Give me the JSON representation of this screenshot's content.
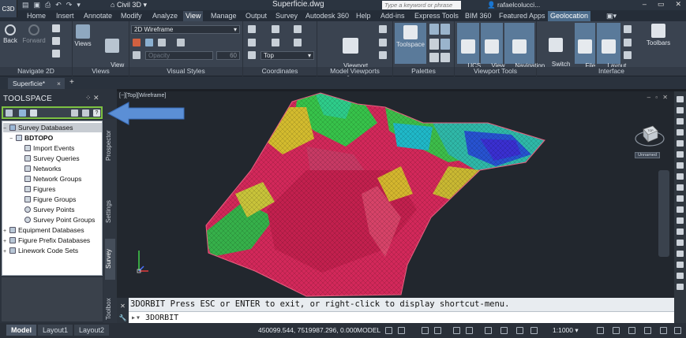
{
  "app_button": "C3D",
  "titlebar": {
    "app_name": "Civil 3D",
    "file_name": "Superficie.dwg",
    "search_placeholder": "Type a keyword or phrase",
    "user": "rafaelcolucci...",
    "window_controls": [
      "–",
      "▭",
      "✕"
    ]
  },
  "ribbon_tabs": [
    "Home",
    "Insert",
    "Annotate",
    "Modify",
    "Analyze",
    "View",
    "Manage",
    "Output",
    "Survey",
    "Autodesk 360",
    "Help",
    "Add-ins",
    "Express Tools",
    "BIM 360",
    "Featured Apps",
    "Geolocation"
  ],
  "active_tab": "View",
  "ribbon": {
    "navigate": {
      "title": "Navigate 2D",
      "back": "Back",
      "forward": "Forward"
    },
    "views": {
      "title": "Views",
      "views": "Views",
      "view_manager": "View\nManager"
    },
    "visual_styles": {
      "title": "Visual Styles",
      "style": "2D Wireframe",
      "opacity": "Opacity",
      "opacity_value": "60"
    },
    "coordinates": {
      "title": "Coordinates",
      "view": "Top"
    },
    "model_viewports": {
      "title": "Model Viewports",
      "viewport_config": "Viewport\nConfiguration"
    },
    "palettes": {
      "title": "Palettes",
      "toolspace": "Toolspace"
    },
    "viewport_tools": {
      "title": "Viewport Tools",
      "ucs_icon": "UCS\nIcon",
      "view_cube": "View\nCube",
      "navigation_bar": "Navigation\nBar"
    },
    "interface": {
      "title": "Interface",
      "switch_windows": "Switch\nWindows",
      "file_tabs": "File\nTabs",
      "layout_tabs": "Layout\nTabs",
      "toolbars": "Toolbars"
    }
  },
  "doc_tab": {
    "label": "Superficie*",
    "close": "×",
    "plus": "+"
  },
  "toolspace": {
    "title": "TOOLSPACE",
    "close": "✕",
    "tree": [
      {
        "label": "Survey Databases",
        "level": 0,
        "expand": "−",
        "selected": true
      },
      {
        "label": "BDTOPO",
        "level": 1,
        "expand": "−",
        "bold": true
      },
      {
        "label": "Import Events",
        "level": 2
      },
      {
        "label": "Survey Queries",
        "level": 2
      },
      {
        "label": "Networks",
        "level": 2
      },
      {
        "label": "Network Groups",
        "level": 2
      },
      {
        "label": "Figures",
        "level": 2
      },
      {
        "label": "Figure Groups",
        "level": 2
      },
      {
        "label": "Survey Points",
        "level": 2
      },
      {
        "label": "Survey Point Groups",
        "level": 2
      },
      {
        "label": "Equipment Databases",
        "level": 0,
        "expand": "+"
      },
      {
        "label": "Figure Prefix Databases",
        "level": 0,
        "expand": "+"
      },
      {
        "label": "Linework Code Sets",
        "level": 0,
        "expand": "+"
      }
    ],
    "vertical_tabs": [
      "Prospector",
      "Settings",
      "Survey",
      "Toolbox"
    ],
    "active_vertical_tab": "Survey"
  },
  "viewport": {
    "label": "[−][Top][Wireframe]",
    "controls": "– ▫ ✕",
    "viewcube_face": "TOP",
    "named_view": "Unnamed"
  },
  "command": {
    "history": "3DORBIT Press ESC or ENTER to exit, or right-click to display shortcut-menu.",
    "prompt": "3DORBIT"
  },
  "status": {
    "layout_tabs": [
      "Model",
      "Layout1",
      "Layout2"
    ],
    "active_layout": "Model",
    "coordinates": "450099.544, 7519987.296, 0.000",
    "space": "MODEL",
    "scale": "1:1000"
  }
}
